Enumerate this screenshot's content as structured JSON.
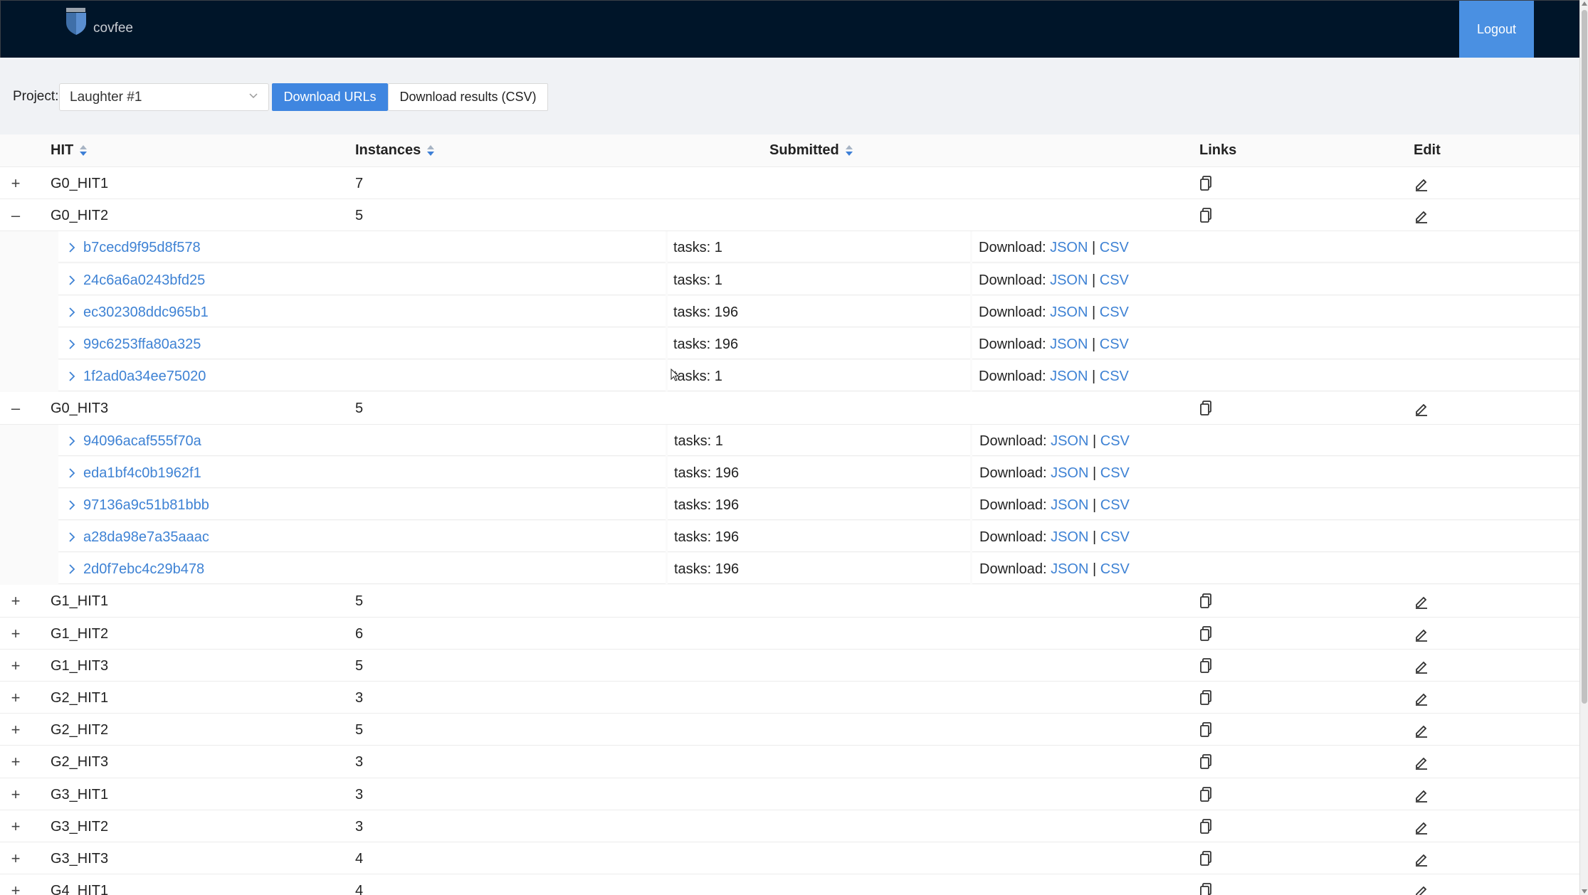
{
  "app": {
    "brand": "covfee",
    "logout_label": "Logout"
  },
  "toolbar": {
    "project_label": "Project:",
    "project_value": "Laughter #1",
    "download_urls_label": "Download URLs",
    "download_results_label": "Download results (CSV)"
  },
  "table": {
    "headers": {
      "hit": "HIT",
      "instances": "Instances",
      "submitted": "Submitted",
      "links": "Links",
      "edit": "Edit"
    },
    "download_label": "Download:",
    "json_label": "JSON",
    "csv_label": "CSV",
    "separator": "|",
    "rows": [
      {
        "name": "G0_HIT1",
        "instances": "7",
        "expanded": false,
        "toggle": "+"
      },
      {
        "name": "G0_HIT2",
        "instances": "5",
        "expanded": true,
        "toggle": "–",
        "children": [
          {
            "id": "b7cecd9f95d8f578",
            "tasks": "tasks: 1"
          },
          {
            "id": "24c6a6a0243bfd25",
            "tasks": "tasks: 1"
          },
          {
            "id": "ec302308ddc965b1",
            "tasks": "tasks: 196"
          },
          {
            "id": "99c6253ffa80a325",
            "tasks": "tasks: 196"
          },
          {
            "id": "1f2ad0a34ee75020",
            "tasks": "tasks: 1"
          }
        ]
      },
      {
        "name": "G0_HIT3",
        "instances": "5",
        "expanded": true,
        "toggle": "–",
        "children": [
          {
            "id": "94096acaf555f70a",
            "tasks": "tasks: 1"
          },
          {
            "id": "eda1bf4c0b1962f1",
            "tasks": "tasks: 196"
          },
          {
            "id": "97136a9c51b81bbb",
            "tasks": "tasks: 196"
          },
          {
            "id": "a28da98e7a35aaac",
            "tasks": "tasks: 196"
          },
          {
            "id": "2d0f7ebc4c29b478",
            "tasks": "tasks: 196"
          }
        ]
      },
      {
        "name": "G1_HIT1",
        "instances": "5",
        "expanded": false,
        "toggle": "+"
      },
      {
        "name": "G1_HIT2",
        "instances": "6",
        "expanded": false,
        "toggle": "+"
      },
      {
        "name": "G1_HIT3",
        "instances": "5",
        "expanded": false,
        "toggle": "+"
      },
      {
        "name": "G2_HIT1",
        "instances": "3",
        "expanded": false,
        "toggle": "+"
      },
      {
        "name": "G2_HIT2",
        "instances": "5",
        "expanded": false,
        "toggle": "+"
      },
      {
        "name": "G2_HIT3",
        "instances": "3",
        "expanded": false,
        "toggle": "+"
      },
      {
        "name": "G3_HIT1",
        "instances": "3",
        "expanded": false,
        "toggle": "+"
      },
      {
        "name": "G3_HIT2",
        "instances": "3",
        "expanded": false,
        "toggle": "+"
      },
      {
        "name": "G3_HIT3",
        "instances": "4",
        "expanded": false,
        "toggle": "+"
      },
      {
        "name": "G4_HIT1",
        "instances": "4",
        "expanded": false,
        "toggle": "+"
      }
    ]
  },
  "colors": {
    "header_bg": "#001529",
    "primary": "#3f86e0",
    "link": "#3e82d4",
    "toolbar_bg": "#f0f2f5"
  },
  "icons": {
    "logo": "covfee-logo-icon",
    "copy": "copy-icon",
    "edit": "edit-icon",
    "expand": "chevron-right-icon",
    "sort": "sort-icon",
    "select": "chevron-down-icon"
  }
}
